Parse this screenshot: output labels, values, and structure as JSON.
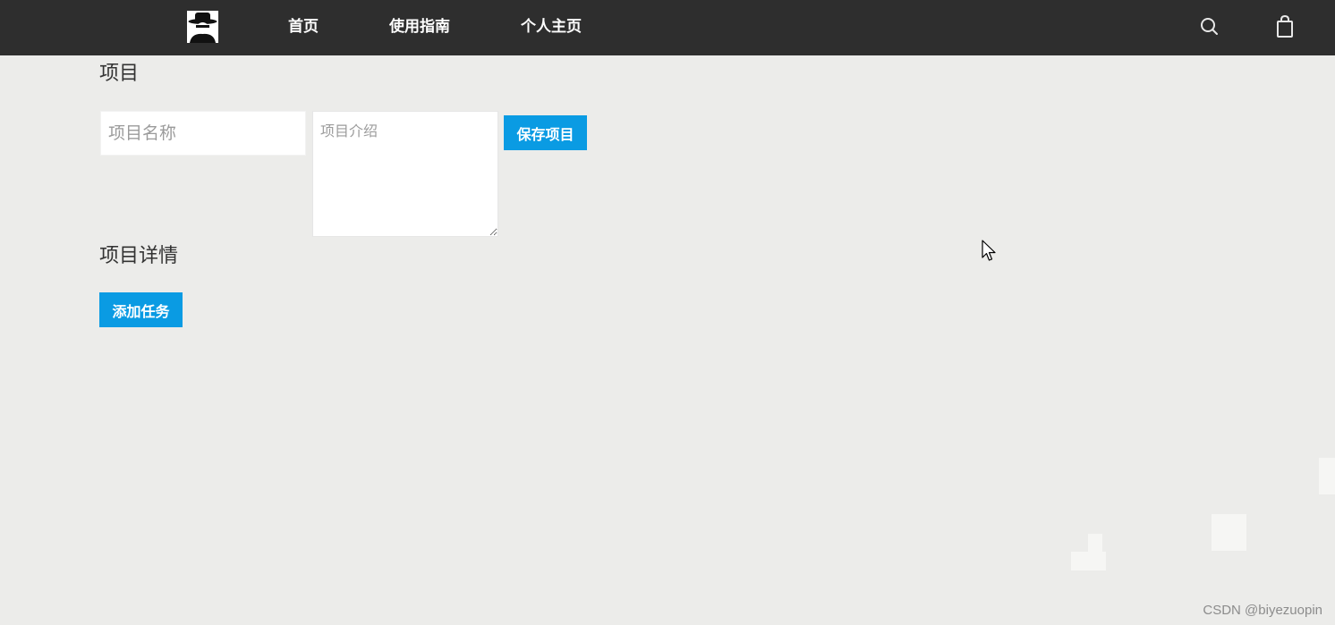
{
  "nav": {
    "links": [
      "首页",
      "使用指南",
      "个人主页"
    ]
  },
  "project": {
    "title": "项目",
    "name_placeholder": "项目名称",
    "name_value": "",
    "description_placeholder": "项目介绍",
    "description_value": "",
    "save_label": "保存项目"
  },
  "details": {
    "title": "项目详情",
    "add_task_label": "添加任务"
  },
  "watermark": "CSDN @biyezuopin",
  "icons": {
    "logo": "user-avatar-hat-icon",
    "search": "search-icon",
    "cart": "shopping-bag-icon",
    "cursor": "mouse-pointer-icon"
  },
  "colors": {
    "topbar": "#2e2e2e",
    "background": "#ececea",
    "accent": "#0a9be3"
  }
}
